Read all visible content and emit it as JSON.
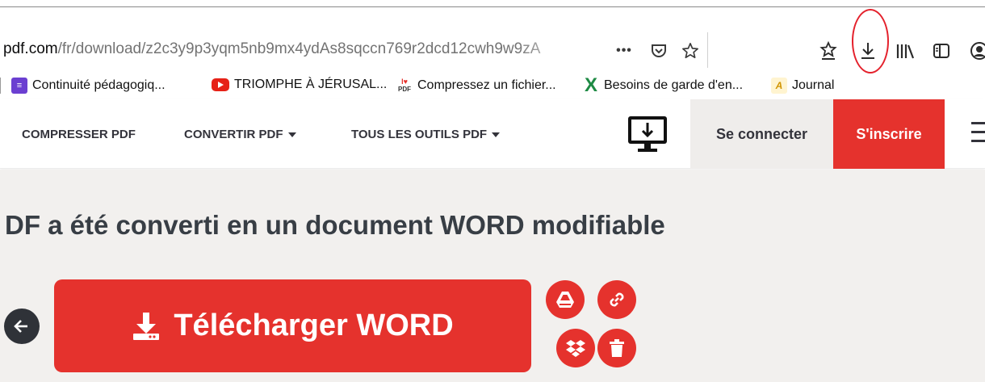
{
  "browser": {
    "url_host": "pdf.com",
    "url_path": "/fr/download/z2c3y9p3yqm5nb9mx4ydAs8sqccn769r2dcd12cwh9w9zA",
    "url_actions": [
      "more-icon",
      "pocket-icon",
      "bookmark-star-icon"
    ],
    "toolbar_icons": [
      "reader-mode-icon",
      "downloads-icon",
      "library-icon",
      "sidebar-icon",
      "account-icon"
    ],
    "bookmarks": [
      {
        "label": "Continuité pédagogiq...",
        "icon": "list-icon",
        "color": "#6b3fd1"
      },
      {
        "label": "TRIOMPHE À JÉRUSAL...",
        "icon": "youtube-icon",
        "color": "#e62117"
      },
      {
        "label": "Compressez un fichier...",
        "icon": "ilovepdf-icon",
        "color": "#e5322d"
      },
      {
        "label": "Besoins de garde d'en...",
        "icon": "excel-icon",
        "color": "#1e8a44"
      },
      {
        "label": "Journal",
        "icon": "journal-icon",
        "color": "#f4b400"
      }
    ]
  },
  "nav": {
    "compress": "COMPRESSER PDF",
    "convert": "CONVERTIR PDF",
    "all_tools": "TOUS LES OUTILS PDF",
    "login": "Se connecter",
    "signup": "S'inscrire"
  },
  "main": {
    "headline": "DF a été converti en un document WORD modifiable",
    "download_label": "Télécharger WORD"
  },
  "colors": {
    "brand_red": "#e5322d",
    "content_bg": "#f2f0ee",
    "annotation_red": "#e4212c"
  }
}
